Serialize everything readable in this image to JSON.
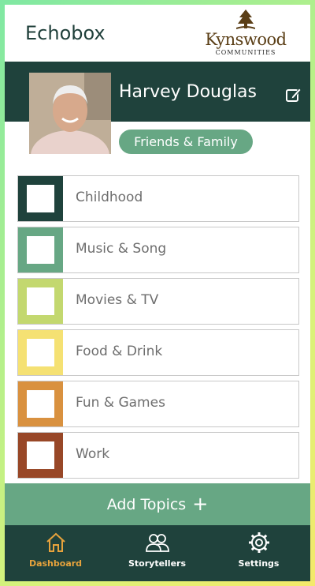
{
  "header": {
    "app_title": "Echobox",
    "logo": {
      "main": "Kynswood",
      "sub": "COMMUNITIES"
    }
  },
  "profile": {
    "name": "Harvey Douglas",
    "group": "Friends & Family"
  },
  "topics": [
    {
      "label": "Childhood",
      "color": "#1f423c"
    },
    {
      "label": "Music & Song",
      "color": "#67a784"
    },
    {
      "label": "Movies & TV",
      "color": "#c3d86f"
    },
    {
      "label": "Food & Drink",
      "color": "#f5e173"
    },
    {
      "label": "Fun & Games",
      "color": "#d9913f"
    },
    {
      "label": "Work",
      "color": "#984727"
    }
  ],
  "add_topics": {
    "label": "Add Topics"
  },
  "tabs": [
    {
      "label": "Dashboard",
      "icon": "home-icon",
      "active": true
    },
    {
      "label": "Storytellers",
      "icon": "people-icon",
      "active": false
    },
    {
      "label": "Settings",
      "icon": "gear-icon",
      "active": false
    }
  ],
  "colors": {
    "dark_green": "#1f423c",
    "accent_green": "#67a784",
    "active_tab": "#e7a33c"
  }
}
